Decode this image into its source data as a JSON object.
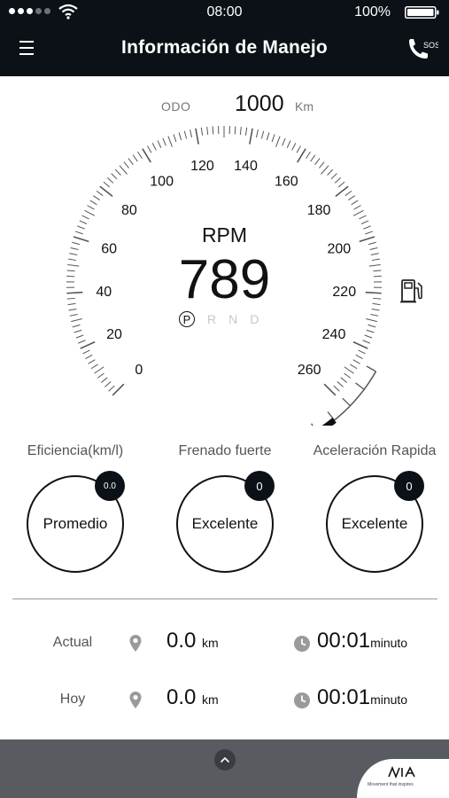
{
  "status_bar": {
    "time": "08:00",
    "battery": "100%",
    "signal_icon": "signal-dots-icon",
    "wifi_icon": "wifi-icon",
    "battery_icon": "battery-icon"
  },
  "header": {
    "title": "Información de Manejo",
    "menu_icon": "hamburger-menu-icon",
    "sos_label": "SOS",
    "sos_icon": "phone-sos-icon",
    "background": "#0c1117"
  },
  "odometer": {
    "label": "ODO",
    "value": "1000",
    "unit": "Km"
  },
  "speedometer": {
    "labels": [
      "0",
      "20",
      "40",
      "60",
      "80",
      "100",
      "120",
      "140",
      "160",
      "180",
      "200",
      "220",
      "240",
      "260"
    ],
    "fuel_icon": "fuel-pump-icon",
    "fuel_level": 0.25
  },
  "rpm": {
    "label": "RPM",
    "value": "789"
  },
  "gears": {
    "active": "P",
    "others": [
      "R",
      "N",
      "D"
    ]
  },
  "stats": [
    {
      "title": "Eficiencia(km/l)",
      "status": "Promedio",
      "badge": "0.0"
    },
    {
      "title": "Frenado fuerte",
      "status": "Excelente",
      "badge": "0"
    },
    {
      "title": "Aceleración Rapida",
      "status": "Excelente",
      "badge": "0"
    }
  ],
  "trips": [
    {
      "label": "Actual",
      "distance": "0.0",
      "distance_unit": "km",
      "duration": "00:01",
      "duration_unit": "minuto"
    },
    {
      "label": "Hoy",
      "distance": "0.0",
      "distance_unit": "km",
      "duration": "00:01",
      "duration_unit": "minuto"
    }
  ],
  "footer": {
    "expand_icon": "chevron-up-icon",
    "brand_logo": "kia-logo",
    "tagline": "Movement that inspires"
  },
  "colors": {
    "accent_dark": "#0c1117",
    "footer_gray": "#585c60"
  }
}
